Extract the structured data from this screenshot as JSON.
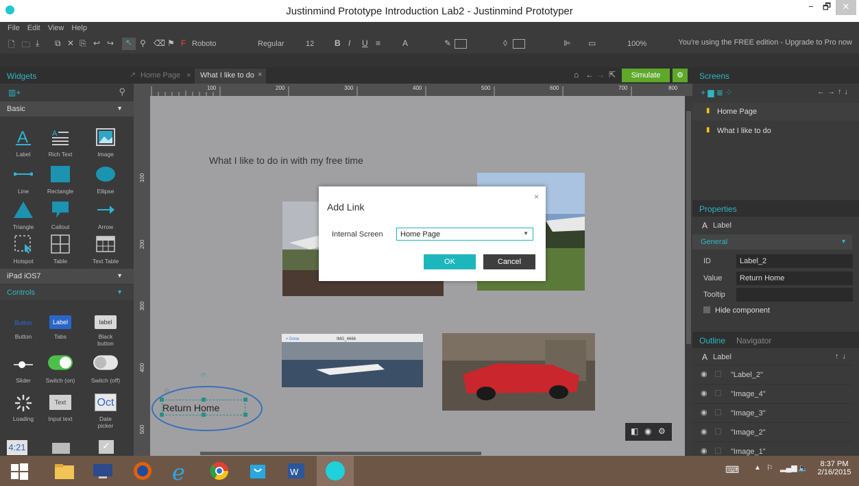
{
  "window": {
    "title": "Justinmind Prototype Introduction Lab2 - Justinmind Prototyper",
    "minimize": "−",
    "maximize": "🗗",
    "close": "✕"
  },
  "menu": [
    "File",
    "Edit",
    "View",
    "Help"
  ],
  "toolbar": {
    "font": "Roboto",
    "weight": "Regular",
    "size": "12",
    "bold": "B",
    "italic": "I",
    "underline": "U",
    "text_color": "A",
    "zoom": "100%",
    "upgrade": "You're using the FREE edition - Upgrade to Pro now"
  },
  "widgets_panel": {
    "title": "Widgets",
    "basic": "Basic",
    "basic_items": [
      "Label",
      "Rich Text",
      "Image",
      "Line",
      "Rectangle",
      "Ellipse",
      "Triangle",
      "Callout",
      "Arrow",
      "Hotspot",
      "Table",
      "Text Table"
    ],
    "ipad": "iPad iOS7",
    "controls": "Controls",
    "control_items": [
      "Button",
      "Tabs",
      "Black button",
      "Slider",
      "Switch (on)",
      "Switch (off)",
      "Loading",
      "Input text",
      "Date picker"
    ],
    "control_previews": {
      "button": "Button",
      "label": "Label",
      "label2": "label",
      "text": "Text",
      "oct": "Oct",
      "time": "4:21"
    }
  },
  "tabs": [
    {
      "label": "Home Page"
    },
    {
      "label": "What I like to do"
    }
  ],
  "simulate_label": "Simulate",
  "ruler": [
    "100",
    "200",
    "300",
    "400",
    "500",
    "600",
    "700",
    "800"
  ],
  "ruler_left": [
    "100",
    "200",
    "300",
    "400",
    "500"
  ],
  "canvas": {
    "heading": "What I like to do in with my free time",
    "return_home": "Return Home"
  },
  "dialog": {
    "title": "Add Link",
    "field_label": "Internal Screen",
    "selected": "Home Page",
    "ok": "OK",
    "cancel": "Cancel"
  },
  "screens": {
    "title": "Screens",
    "items": [
      "Home Page",
      "What I like to do"
    ]
  },
  "properties": {
    "title": "Properties",
    "type": "Label",
    "section": "General",
    "id_label": "ID",
    "id_value": "Label_2",
    "value_label": "Value",
    "value_value": "Return Home",
    "tooltip_label": "Tooltip",
    "tooltip_value": "",
    "hide": "Hide component"
  },
  "outline": {
    "tab_outline": "Outline",
    "tab_navigator": "Navigator",
    "root": "Label",
    "items": [
      "\"Label_2\"",
      "\"Image_4\"",
      "\"Image_3\"",
      "\"Image_2\"",
      "\"Image_1\""
    ]
  },
  "taskbar": {
    "time": "8:37 PM",
    "date": "2/16/2015"
  },
  "colors": {
    "accent": "#1fbfc9",
    "simulate": "#5ea82a",
    "ok": "#1eb6bd",
    "cancel": "#3e3e3e"
  }
}
